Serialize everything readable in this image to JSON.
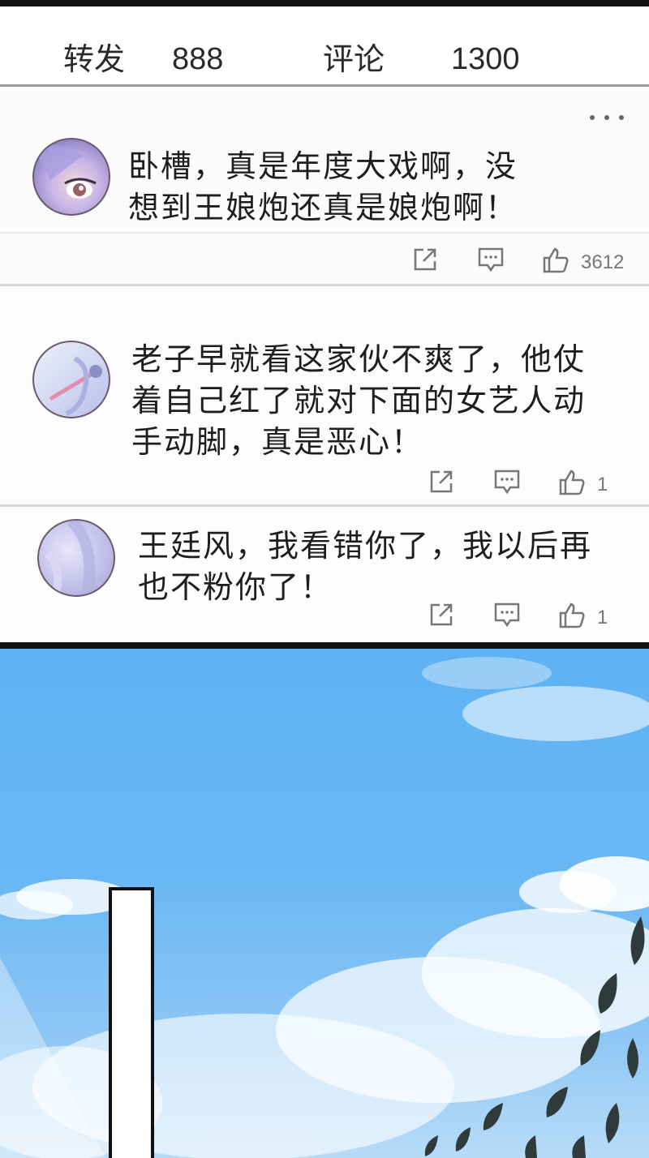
{
  "stats": {
    "repost_label": "转发",
    "repost_count": "888",
    "comment_label": "评论",
    "comment_count": "1300"
  },
  "comments": [
    {
      "text": "卧槽，真是年度大戏啊，没\n想到王娘炮还真是娘炮啊！",
      "like_count": "3612"
    },
    {
      "text": "老子早就看这家伙不爽了，他仗\n着自己红了就对下面的女艺人动\n手动脚，真是恶心！",
      "like_count": "1"
    },
    {
      "text": "王廷风，我看错你了，我以后再\n也不粉你了！",
      "like_count": "1"
    }
  ],
  "icons": {
    "share": "share-icon",
    "reply": "comment-icon",
    "like": "thumbs-up-icon",
    "more": "more-dots-icon"
  },
  "colors": {
    "sky": "#69b7f4",
    "text": "#1e1e1e",
    "icon": "#777777",
    "avatar_border": "#6d5a6e"
  }
}
